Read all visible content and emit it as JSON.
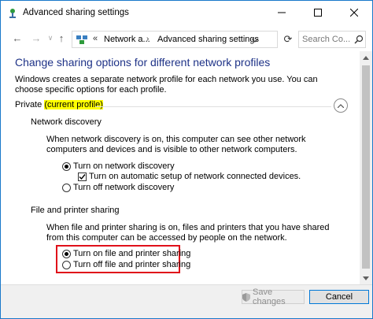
{
  "window": {
    "title": "Advanced sharing settings"
  },
  "nav": {
    "back": "←",
    "forward": "→",
    "recent": "∨",
    "up": "↑",
    "address_sep1": "«",
    "crumb1": "Network a...",
    "address_sep2": "›",
    "crumb2": "Advanced sharing settings",
    "refresh": "⟳",
    "search_placeholder": "Search Co..."
  },
  "content": {
    "heading": "Change sharing options for different network profiles",
    "description": "Windows creates a separate network profile for each network you use. You can choose specific options for each profile.",
    "profile": {
      "name": "Private",
      "tag": "(current profile)"
    },
    "network_discovery": {
      "title": "Network discovery",
      "description": "When network discovery is on, this computer can see other network computers and devices and is visible to other network computers.",
      "opt_on": "Turn on network discovery",
      "opt_auto": "Turn on automatic setup of network connected devices.",
      "opt_off": "Turn off network discovery"
    },
    "file_sharing": {
      "title": "File and printer sharing",
      "description": "When file and printer sharing is on, files and printers that you have shared from this computer can be accessed by people on the network.",
      "opt_on": "Turn on file and printer sharing",
      "opt_off": "Turn off file and printer sharing"
    }
  },
  "footer": {
    "save": "Save changes",
    "cancel": "Cancel"
  },
  "colors": {
    "accent": "#1979ca",
    "heading": "#1e3287",
    "highlight": "#ffff00",
    "red_outline": "#e0101a"
  }
}
